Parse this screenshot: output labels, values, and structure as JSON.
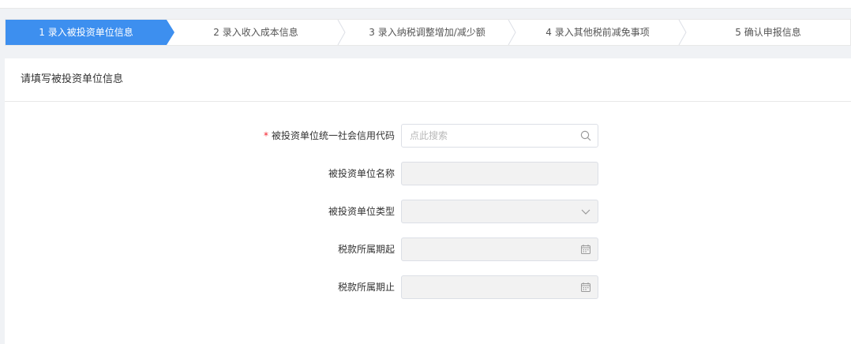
{
  "steps": [
    {
      "label": "1 录入被投资单位信息",
      "active": true
    },
    {
      "label": "2 录入收入成本信息",
      "active": false
    },
    {
      "label": "3 录入纳税调整增加/减少额",
      "active": false
    },
    {
      "label": "4 录入其他税前减免事项",
      "active": false
    },
    {
      "label": "5 确认申报信息",
      "active": false
    }
  ],
  "section": {
    "title": "请填写被投资单位信息"
  },
  "form": {
    "credit_code": {
      "required_mark": "*",
      "label": "被投资单位统一社会信用代码",
      "placeholder": "点此搜索",
      "value": "",
      "icon": "search-icon"
    },
    "name": {
      "label": "被投资单位名称",
      "value": ""
    },
    "type": {
      "label": "被投资单位类型",
      "value": "",
      "icon": "chevron-down-icon"
    },
    "period_start": {
      "label": "税款所属期起",
      "value": "",
      "icon": "calendar-icon"
    },
    "period_end": {
      "label": "税款所属期止",
      "value": "",
      "icon": "calendar-icon"
    }
  },
  "colors": {
    "accent": "#3d8fef",
    "required": "#f5222d",
    "disabled_bg": "#f2f2f2",
    "page_bg": "#f0f2f5"
  }
}
